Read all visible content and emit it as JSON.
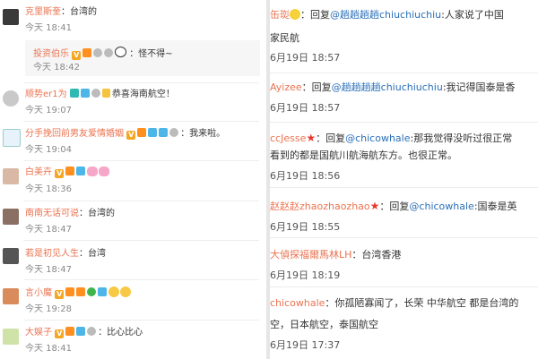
{
  "left": {
    "comments": [
      {
        "name": "克里斯奎",
        "text": "：台湾的",
        "time": "今天 18:41"
      },
      {
        "name": "投资伯乐",
        "text": "：怪不得~",
        "time": "今天 18:42"
      },
      {
        "name": "顺势er1为",
        "text": "恭喜海南航空！",
        "time": "今天 19:07"
      },
      {
        "name": "分手挽回前男友爱情婚姻",
        "text": "：我来啦。",
        "time": "今天 19:04"
      },
      {
        "name": "白美卉",
        "text": "",
        "time": "今天 18:36"
      },
      {
        "name": "南南无话可说",
        "text": "：台湾的",
        "time": "今天 18:47"
      },
      {
        "name": "若是初见人生",
        "text": "：台湾",
        "time": "今天 18:47"
      },
      {
        "name": "言小魔",
        "text": "",
        "time": "今天 19:28"
      },
      {
        "name": "大娱子",
        "text": "：比心比心",
        "time": "今天 18:41"
      }
    ]
  },
  "right": {
    "comments": [
      {
        "name": "缶珳",
        "mid": "：回复",
        "mention": "@趟趟趟趟chiuchiuchiu",
        "text": ":人家说了中国",
        "cont": "家民航",
        "time": "6月19日 18:57"
      },
      {
        "name": "Ayizee",
        "mid": "：回复",
        "mention": "@趟趟趟趟chiuchiuchiu",
        "text": ":我记得国泰是香",
        "cont": "",
        "time": "6月19日 18:57"
      },
      {
        "name": "ccJesse",
        "mid": "：回复",
        "mention": "@chicowhale",
        "text": ":那我觉得没听过很正常",
        "cont": "看到的都是国航川航海航东方。也很正常。",
        "time": "6月19日 18:56"
      },
      {
        "name": "赵赵赵zhaozhaozhao",
        "mid": "：回复",
        "mention": "@chicowhale",
        "text": ":国泰是英",
        "cont": "",
        "time": "6月19日 18:55"
      },
      {
        "name": "大偵探福爾馬林LH",
        "mid": "：台湾香港",
        "mention": "",
        "text": "",
        "cont": "",
        "time": "6月19日 18:19"
      },
      {
        "name": "chicowhale",
        "mid": "：你孤陋寡闻了，长荣 中华航空 都是台湾的",
        "mention": "",
        "text": "",
        "cont": "空，日本航空，泰国航空",
        "time": "6月19日 17:37"
      }
    ]
  }
}
